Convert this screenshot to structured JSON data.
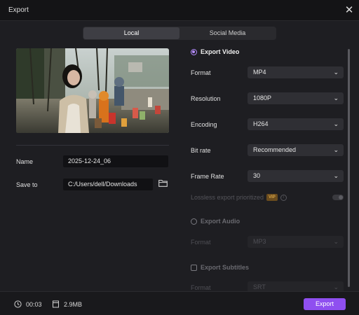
{
  "window": {
    "title": "Export"
  },
  "tabs": [
    {
      "label": "Local",
      "active": true
    },
    {
      "label": "Social Media",
      "active": false
    }
  ],
  "left": {
    "name_label": "Name",
    "name_value": "2025-12-24_06",
    "save_label": "Save to",
    "save_value": "C:/Users/dell/Downloads"
  },
  "video": {
    "heading": "Export Video",
    "format_label": "Format",
    "format_value": "MP4",
    "resolution_label": "Resolution",
    "resolution_value": "1080P",
    "encoding_label": "Encoding",
    "encoding_value": "H264",
    "bitrate_label": "Bit rate",
    "bitrate_value": "Recommended",
    "framerate_label": "Frame Rate",
    "framerate_value": "30",
    "lossless_label": "Lossless export prioritized",
    "vip_badge": "VIP"
  },
  "audio": {
    "heading": "Export Audio",
    "format_label": "Format",
    "format_value": "MP3"
  },
  "subtitles": {
    "heading": "Export Subtitles",
    "format_label": "Format",
    "format_value": "SRT"
  },
  "footer": {
    "duration": "00:03",
    "size": "2.9MB",
    "export_label": "Export"
  },
  "colors": {
    "accent": "#8f4ff0",
    "radio_accent": "#b58cff",
    "background": "#1e1e22",
    "titlebar": "#141416"
  },
  "icons": [
    "close-icon",
    "folder-icon",
    "chevron-down-icon",
    "clock-icon",
    "file-icon",
    "info-icon"
  ]
}
